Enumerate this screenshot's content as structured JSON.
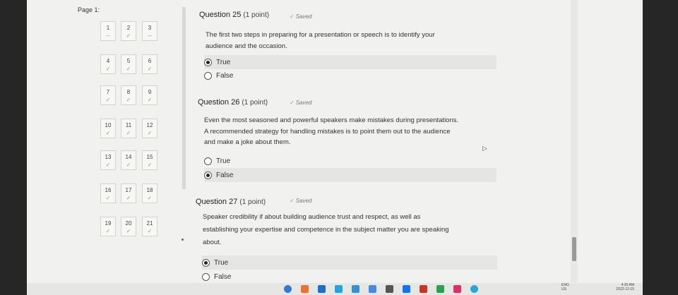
{
  "nav": {
    "title": "Page 1:",
    "cells": [
      {
        "num": "1",
        "mark": "--"
      },
      {
        "num": "2",
        "mark": "✓"
      },
      {
        "num": "3",
        "mark": "--"
      },
      {
        "num": "4",
        "mark": "✓"
      },
      {
        "num": "5",
        "mark": "✓"
      },
      {
        "num": "6",
        "mark": "✓"
      },
      {
        "num": "7",
        "mark": "✓"
      },
      {
        "num": "8",
        "mark": "✓"
      },
      {
        "num": "9",
        "mark": "✓"
      },
      {
        "num": "10",
        "mark": "✓"
      },
      {
        "num": "11",
        "mark": "✓"
      },
      {
        "num": "12",
        "mark": "✓"
      },
      {
        "num": "13",
        "mark": "✓"
      },
      {
        "num": "14",
        "mark": "✓"
      },
      {
        "num": "15",
        "mark": "✓"
      },
      {
        "num": "16",
        "mark": "✓"
      },
      {
        "num": "17",
        "mark": "✓"
      },
      {
        "num": "18",
        "mark": "✓"
      },
      {
        "num": "19",
        "mark": "✓"
      },
      {
        "num": "20",
        "mark": "✓"
      },
      {
        "num": "21",
        "mark": "✓"
      }
    ]
  },
  "questions": [
    {
      "title": "Question 25",
      "points": "(1 point)",
      "saved": "Saved",
      "text": [
        "The first two steps in preparing for a presentation or speech is to identify your",
        "audience and the occasion."
      ],
      "options": [
        {
          "label": "True",
          "selected": true
        },
        {
          "label": "False",
          "selected": false
        }
      ]
    },
    {
      "title": "Question 26",
      "points": "(1 point)",
      "saved": "Saved",
      "text": [
        "Even the most seasoned and powerful speakers make mistakes during presentations.",
        "A recommended strategy for handling mistakes is to point them out to the audience",
        "and make a joke about them."
      ],
      "options": [
        {
          "label": "True",
          "selected": false
        },
        {
          "label": "False",
          "selected": true
        }
      ]
    },
    {
      "title": "Question 27",
      "points": "(1 point)",
      "saved": "Saved",
      "text": [
        "Speaker credibility if about building audience trust and respect, as well as",
        "establishing your expertise and competence in the subject matter you are speaking",
        "about."
      ],
      "options": [
        {
          "label": "True",
          "selected": true
        },
        {
          "label": "False",
          "selected": false
        }
      ]
    }
  ],
  "taskbar": {
    "lang": "ENG",
    "region": "US",
    "time": "4:30 AM",
    "date": "2022-12-15",
    "icon_colors": [
      "#2e7bd6",
      "#e8743b",
      "#1f6fc5",
      "#2aa3d8",
      "#3a8fd1",
      "#4b8ad6",
      "#555555",
      "#1473e6",
      "#c0392b",
      "#2e9e4f",
      "#d6336c",
      "#2ba4d9"
    ]
  },
  "colors": {
    "accent_check": "#7fa86c",
    "background": "#f1f1ef"
  }
}
